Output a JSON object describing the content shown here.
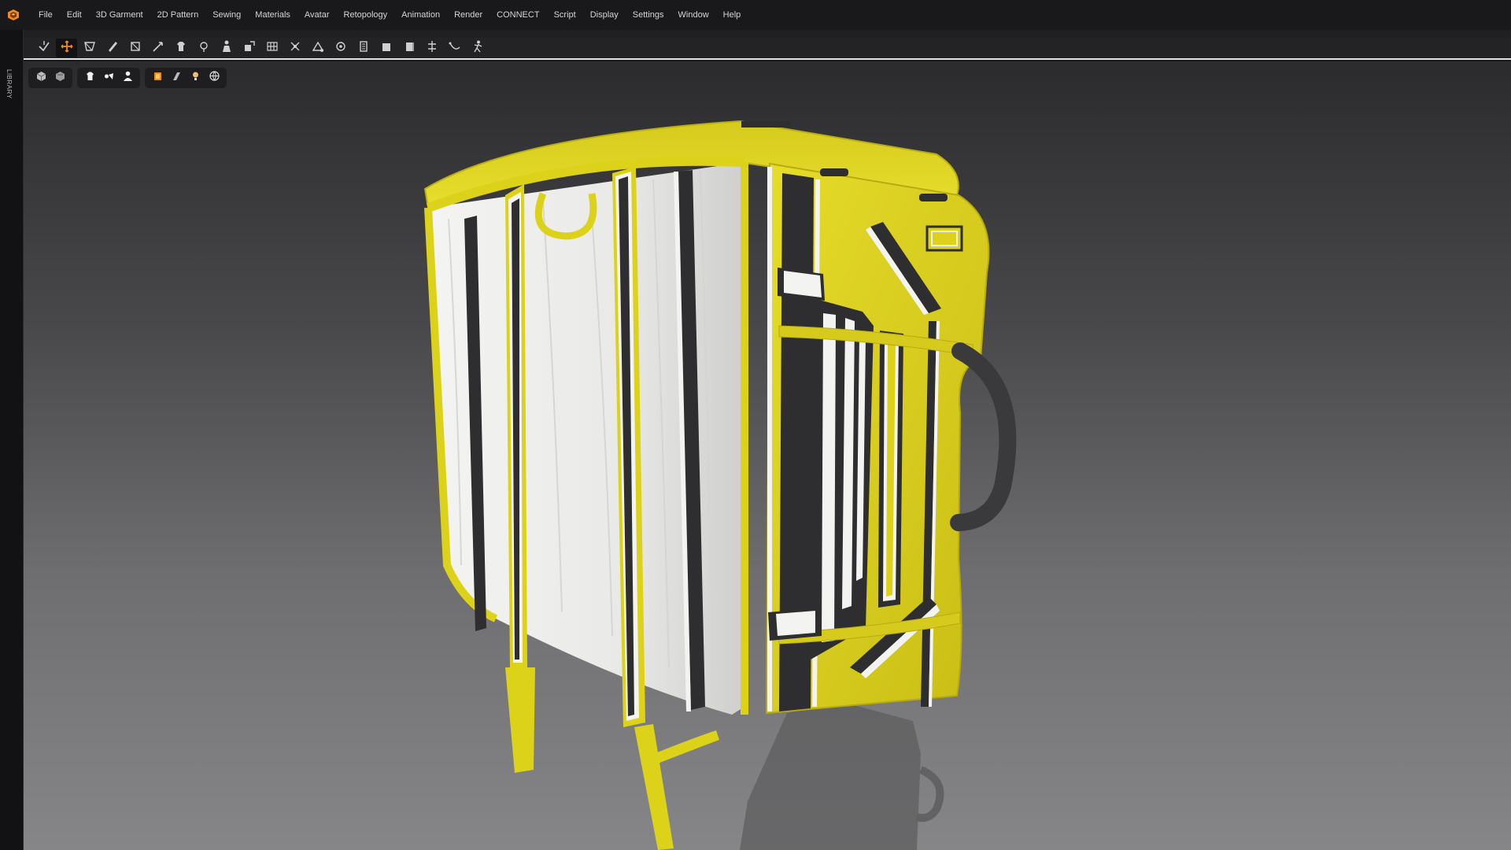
{
  "menubar": {
    "items": [
      "File",
      "Edit",
      "3D Garment",
      "2D Pattern",
      "Sewing",
      "Materials",
      "Avatar",
      "Retopology",
      "Animation",
      "Render",
      "CONNECT",
      "Script",
      "Display",
      "Settings",
      "Window",
      "Help"
    ]
  },
  "sidebar": {
    "label": "LIBRARY"
  },
  "toolbar": {
    "tools": [
      "simulation",
      "select-move",
      "select-mesh",
      "brush",
      "fold-arrangement",
      "move-tool",
      "garment-arrangement",
      "pin",
      "avatar-arrange",
      "scale",
      "grid",
      "tack",
      "transform-pattern",
      "set-point",
      "measure",
      "block",
      "block-alt",
      "align",
      "curve",
      "avatar-pose"
    ],
    "active_tool_index": 1
  },
  "viewport_toolbar": {
    "groups": [
      [
        "cube-view",
        "cube-alt-view"
      ],
      [
        "garment-view",
        "fabric-view",
        "avatar-view"
      ],
      [
        "texture-view",
        "shading-view",
        "lighting-view",
        "environment-view"
      ]
    ]
  },
  "colors": {
    "accent": "#f08a1c",
    "bag_yellow": "#ddd21a",
    "bag_white": "#ececea",
    "bag_dark": "#2e2e30"
  }
}
